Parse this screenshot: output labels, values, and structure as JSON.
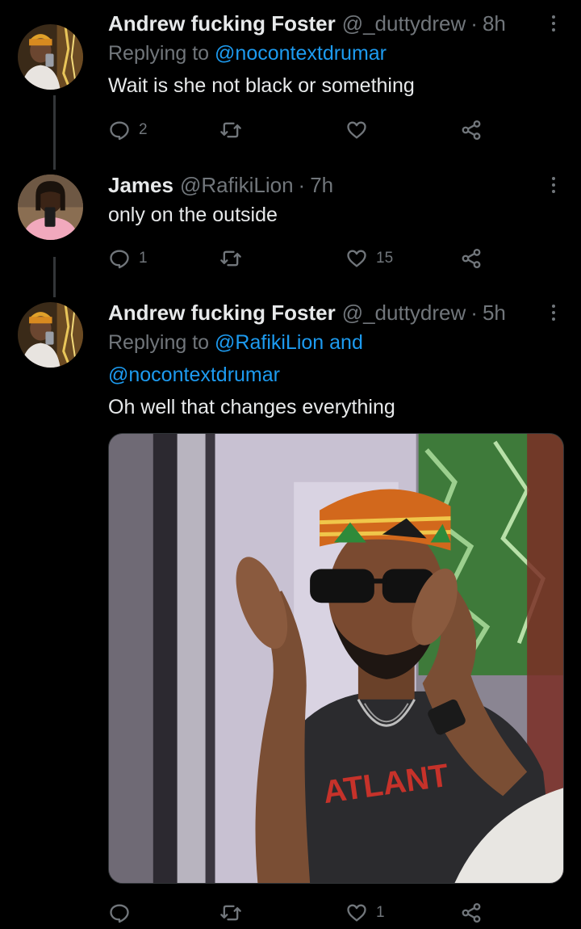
{
  "tweets": [
    {
      "name": "Andrew fucking Foster",
      "handle": "@_duttydrew",
      "separator": "·",
      "time": "8h",
      "replying_prefix": "Replying to",
      "replying_to": "@nocontextdrumar",
      "text": "Wait is she not black or something",
      "reply_count": "2",
      "retweet_count": "",
      "like_count": ""
    },
    {
      "name": "James",
      "handle": "@RafikiLion",
      "separator": "·",
      "time": "7h",
      "text": "only on the outside",
      "reply_count": "1",
      "retweet_count": "",
      "like_count": "15"
    },
    {
      "name": "Andrew fucking Foster",
      "handle": "@_duttydrew",
      "separator": "·",
      "time": "5h",
      "replying_prefix": "Replying to",
      "replying_to_1": "@RafikiLion",
      "replying_and": "and",
      "replying_to_2": "@nocontextdrumar",
      "text": "Oh well that changes everything",
      "media_shirt_text": "ATLANT",
      "reply_count": "",
      "retweet_count": "",
      "like_count": "1"
    }
  ],
  "icons": {
    "reply": "reply-icon",
    "retweet": "retweet-icon",
    "like": "heart-icon",
    "share": "share-icon",
    "more": "more-icon"
  },
  "colors": {
    "background": "#000000",
    "text": "#e7e9ea",
    "muted": "#71767b",
    "link": "#1d9bf0"
  }
}
